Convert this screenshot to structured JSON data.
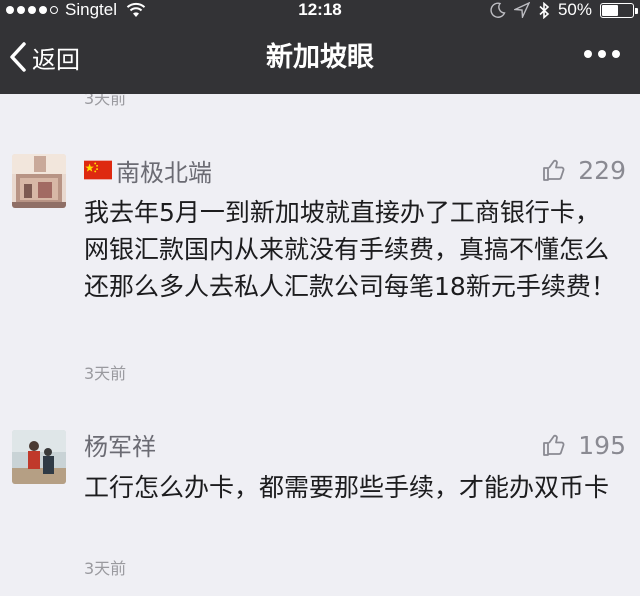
{
  "status_bar": {
    "carrier": "Singtel",
    "time": "12:18",
    "battery": "50%",
    "battery_level": 0.5,
    "signal_bars_filled": 4
  },
  "nav": {
    "back_label": "返回",
    "title": "新加坡眼"
  },
  "previous_comment_time": "3天前",
  "comments": [
    {
      "username": "南极北端",
      "likes": "229",
      "text": "我去年5月一到新加坡就直接办了工商银行卡，网银汇款国内从来就没有手续费，真搞不懂怎么还那么多人去私人汇款公司每笔18新元手续费！",
      "time": "3天前"
    },
    {
      "username": "杨军祥",
      "likes": "195",
      "text": "工行怎么办卡，都需要那些手续，才能办双币卡",
      "time": "3天前"
    }
  ],
  "colors": {
    "bar_bg": "#333336",
    "page_bg": "#efeff4",
    "meta_text": "#9a9a9f",
    "name_text": "#6b6b73"
  },
  "icons": [
    "wifi-icon",
    "moon-icon",
    "location-icon",
    "bluetooth-icon",
    "battery-icon",
    "back-chevron-icon",
    "more-icon",
    "thumbs-up-icon",
    "china-flag-icon"
  ]
}
